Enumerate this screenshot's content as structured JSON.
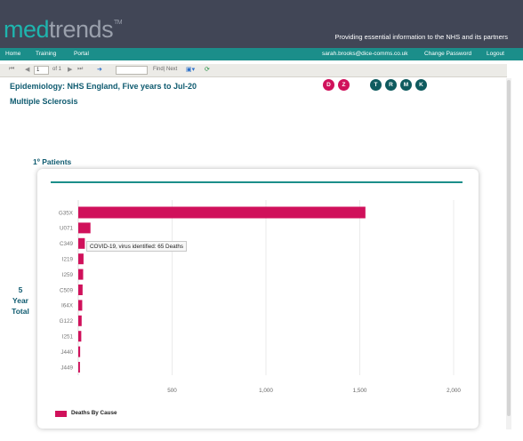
{
  "header": {
    "logo_part1": "med",
    "logo_part2": "trends",
    "logo_tm": "TM",
    "tagline": "Providing essential information to the NHS and its partners"
  },
  "nav": {
    "home": "Home",
    "training": "Training",
    "portal": "Portal",
    "email": "sarah.brooks@dice-comms.co.uk",
    "change_password": "Change Password",
    "logout": "Logout"
  },
  "report_toolbar": {
    "page_value": "1",
    "page_of": "of 1",
    "find_value": "",
    "find_label": "Find",
    "separator": "|",
    "next_label": "Next",
    "icons": [
      "first-page-icon",
      "prev-page-icon",
      "next-page-icon",
      "last-page-icon",
      "back-icon",
      "export-icon",
      "refresh-icon"
    ]
  },
  "report": {
    "title": "Epidemiology: NHS England, Five years to Jul-20",
    "subtitle": "Multiple Sclerosis",
    "section_label": "1º Patients",
    "side_label_1": "5",
    "side_label_2": "Year",
    "side_label_3": "Total",
    "circles": [
      {
        "label": "D",
        "color": "#d0115b"
      },
      {
        "label": "Z",
        "color": "#d0115b"
      },
      {
        "label": "T",
        "color": "#0f5b5f"
      },
      {
        "label": "R",
        "color": "#0f5b5f"
      },
      {
        "label": "M",
        "color": "#0f5b5f"
      },
      {
        "label": "K",
        "color": "#0f5b5f"
      }
    ]
  },
  "colors": {
    "header_bg": "#414656",
    "nav_bg": "#1b8e8a",
    "accent_teal": "#1eb5ae",
    "bar": "#d0115b",
    "title_text": "#0f5b70"
  },
  "tooltip": {
    "text": "COVID-19, virus identified: 65 Deaths"
  },
  "chart_data": {
    "type": "bar",
    "orientation": "horizontal",
    "categories": [
      "G35X",
      "U071",
      "C349",
      "I219",
      "I259",
      "C509",
      "I64X",
      "G122",
      "I251",
      "J440",
      "J449"
    ],
    "series": [
      {
        "name": "Deaths By Cause",
        "values": [
          1530,
          65,
          35,
          28,
          26,
          23,
          21,
          18,
          16,
          10,
          9
        ]
      }
    ],
    "xticks": [
      "500",
      "1,000",
      "1,500",
      "2,000"
    ],
    "xlim": [
      0,
      2000
    ],
    "legend": "bottom-left",
    "grid": true
  }
}
